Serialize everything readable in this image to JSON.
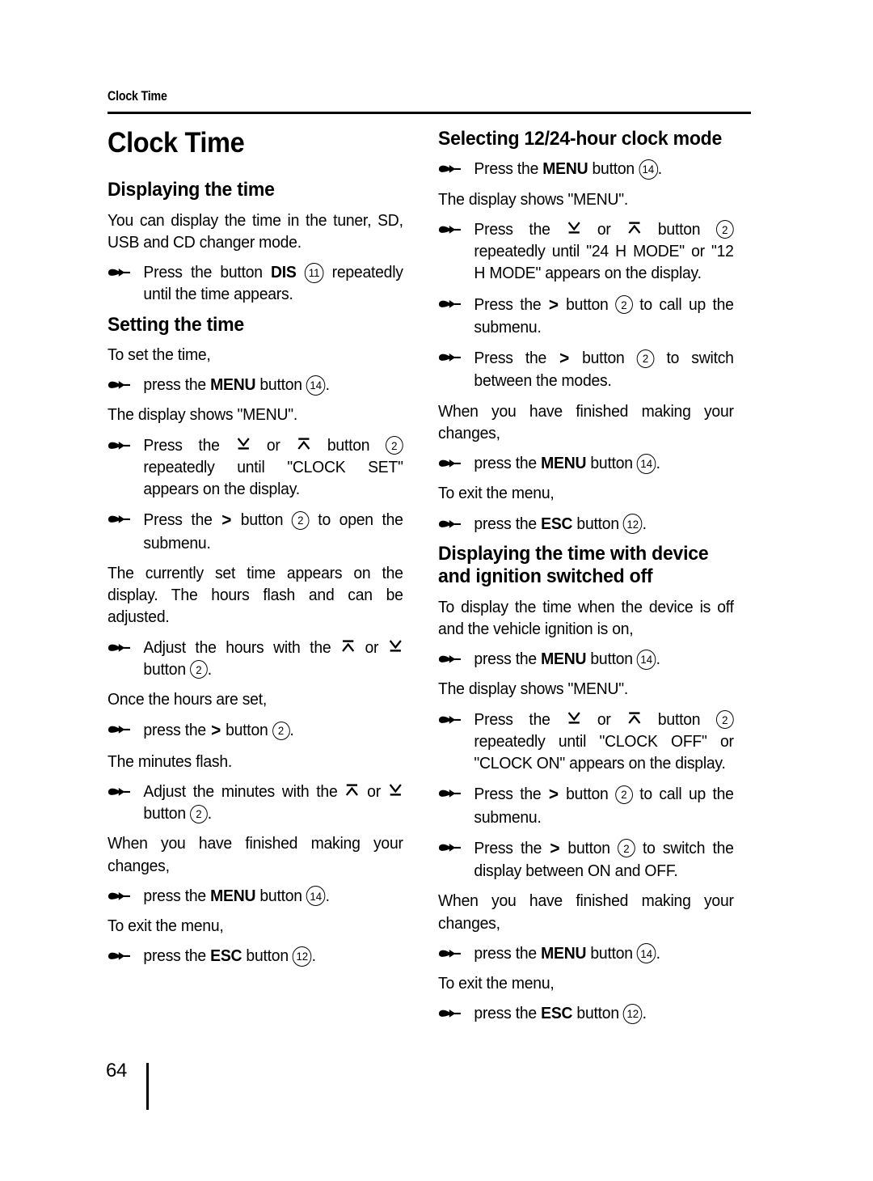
{
  "document": {
    "running_header": "Clock Time",
    "page_number": "64"
  },
  "icons": {
    "hand": "pointing-hand-icon",
    "arrow_down": "arrow-down-bar-icon",
    "arrow_up": "arrow-up-bar-icon",
    "chevron_right": ">"
  },
  "left_column": {
    "chapter_title": "Clock Time",
    "sections": [
      {
        "title": "Displaying the time",
        "blocks": [
          {
            "type": "para",
            "text": "You can display the time in the tuner, SD, USB and CD changer mode."
          },
          {
            "type": "step",
            "pre": "Press the button ",
            "strong": "DIS",
            "mid": "",
            "ref": "11",
            "post": " repeatedly until the time appears."
          }
        ]
      },
      {
        "title": "Setting the time",
        "blocks": [
          {
            "type": "para",
            "text": "To set the time,"
          },
          {
            "type": "step",
            "pre": "press the ",
            "strong": "MENU",
            "mid": " button ",
            "ref": "14",
            "post": "."
          },
          {
            "type": "para",
            "text": "The display shows \"MENU\"."
          },
          {
            "type": "step-arrows",
            "pre": "Press the ",
            "arrows": "down-or-up",
            "mid": " button ",
            "ref": "2",
            "post": " repeatedly until \"CLOCK SET\" appears on the display."
          },
          {
            "type": "step-gt",
            "pre": "Press the ",
            "mid": " button ",
            "ref": "2",
            "post": " to open the submenu."
          },
          {
            "type": "para",
            "text": "The currently set time appears on the display. The hours flash and can be adjusted."
          },
          {
            "type": "step-arrows",
            "pre": "Adjust the hours with the ",
            "arrows": "up-or-down",
            "mid": " button ",
            "ref": "2",
            "post": "."
          },
          {
            "type": "para",
            "text": "Once the hours are set,"
          },
          {
            "type": "step-gt",
            "pre": "press the ",
            "mid": " button ",
            "ref": "2",
            "post": "."
          },
          {
            "type": "para",
            "text": "The minutes flash."
          },
          {
            "type": "step-arrows",
            "pre": "Adjust the minutes with the ",
            "arrows": "up-or-down",
            "mid": " button ",
            "ref": "2",
            "post": "."
          },
          {
            "type": "para",
            "text": "When you have finished making your changes,"
          },
          {
            "type": "step",
            "pre": "press the ",
            "strong": "MENU",
            "mid": " button ",
            "ref": "14",
            "post": "."
          },
          {
            "type": "para",
            "text": "To exit the menu,"
          },
          {
            "type": "step",
            "pre": "press the ",
            "strong": "ESC",
            "mid": " button ",
            "ref": "12",
            "post": "."
          }
        ]
      }
    ]
  },
  "right_column": {
    "sections": [
      {
        "title": "Selecting 12/24-hour clock mode",
        "blocks": [
          {
            "type": "step",
            "pre": "Press the ",
            "strong": "MENU",
            "mid": " button ",
            "ref": "14",
            "post": "."
          },
          {
            "type": "para",
            "text": "The display shows \"MENU\"."
          },
          {
            "type": "step-arrows",
            "pre": "Press the ",
            "arrows": "down-or-up",
            "mid": " button ",
            "ref": "2",
            "post": " repeatedly until \"24 H MODE\" or \"12 H MODE\" appears on the display."
          },
          {
            "type": "step-gt",
            "pre": "Press the ",
            "mid": " button ",
            "ref": "2",
            "post": " to call up the submenu."
          },
          {
            "type": "step-gt",
            "pre": "Press the ",
            "mid": " button ",
            "ref": "2",
            "post": " to switch between the modes."
          },
          {
            "type": "para",
            "text": "When you have finished making your changes,"
          },
          {
            "type": "step",
            "pre": "press the ",
            "strong": "MENU",
            "mid": " button ",
            "ref": "14",
            "post": "."
          },
          {
            "type": "para",
            "text": "To exit the menu,"
          },
          {
            "type": "step",
            "pre": "press the ",
            "strong": "ESC",
            "mid": " button ",
            "ref": "12",
            "post": "."
          }
        ]
      },
      {
        "title": "Displaying the time with device and ignition switched off",
        "blocks": [
          {
            "type": "para",
            "text": "To display the time when the device is off and the vehicle ignition is on,"
          },
          {
            "type": "step",
            "pre": "press the ",
            "strong": "MENU",
            "mid": " button ",
            "ref": "14",
            "post": "."
          },
          {
            "type": "para",
            "text": "The display shows \"MENU\"."
          },
          {
            "type": "step-arrows",
            "pre": "Press the ",
            "arrows": "down-or-up",
            "mid": " button ",
            "ref": "2",
            "post": " repeatedly until \"CLOCK OFF\" or \"CLOCK ON\" appears on the display."
          },
          {
            "type": "step-gt",
            "pre": "Press the ",
            "mid": " button ",
            "ref": "2",
            "post": " to call up the submenu."
          },
          {
            "type": "step-gt",
            "pre": "Press the ",
            "mid": " button ",
            "ref": "2",
            "post": " to switch the display between ON and OFF."
          },
          {
            "type": "para",
            "text": "When you have finished making your changes,"
          },
          {
            "type": "step",
            "pre": "press the ",
            "strong": "MENU",
            "mid": " button ",
            "ref": "14",
            "post": "."
          },
          {
            "type": "para",
            "text": "To exit the menu,"
          },
          {
            "type": "step",
            "pre": "press the ",
            "strong": "ESC",
            "mid": " button ",
            "ref": "12",
            "post": "."
          }
        ]
      }
    ]
  },
  "text": {
    "or": " or "
  }
}
